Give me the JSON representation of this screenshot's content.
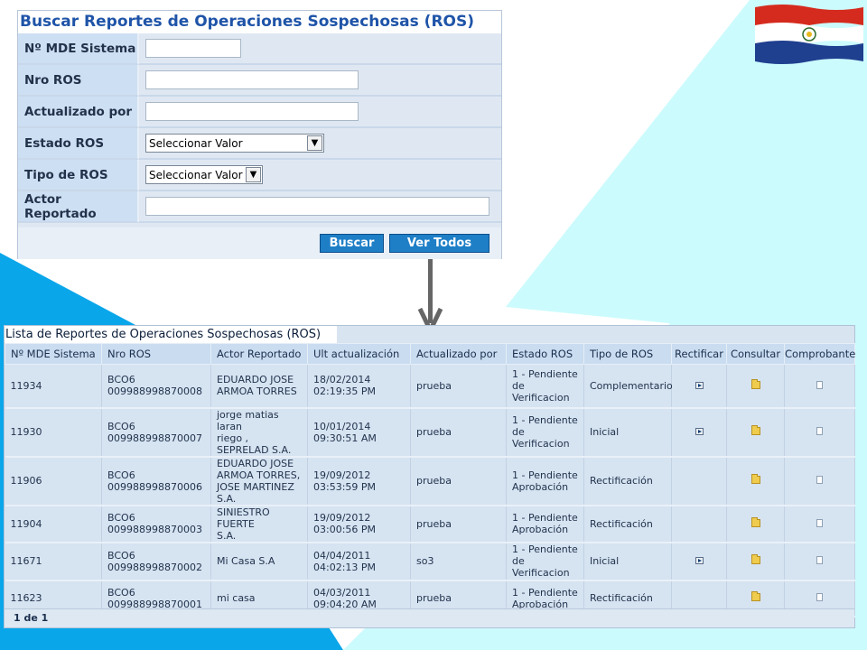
{
  "search": {
    "title": "Buscar Reportes de Operaciones Sospechosas (ROS)",
    "fields": [
      {
        "label": "Nº MDE Sistema",
        "type": "text",
        "value": ""
      },
      {
        "label": "Nro ROS",
        "type": "text",
        "value": ""
      },
      {
        "label": "Actualizado por",
        "type": "text",
        "value": ""
      },
      {
        "label": "Estado ROS",
        "type": "select",
        "value": "Seleccionar Valor"
      },
      {
        "label": "Tipo de ROS",
        "type": "select",
        "value": "Seleccionar Valor"
      },
      {
        "label": "Actor Reportado",
        "type": "text",
        "value": ""
      }
    ],
    "buttons": {
      "search": "Buscar",
      "view_all": "Ver Todos"
    }
  },
  "list": {
    "title": "Lista de Reportes de Operaciones Sospechosas (ROS)",
    "columns": [
      "Nº MDE Sistema",
      "Nro ROS",
      "Actor Reportado",
      "Ult actualización",
      "Actualizado por",
      "Estado ROS",
      "Tipo de ROS",
      "Rectificar",
      "Consultar",
      "Comprobante"
    ],
    "rows": [
      {
        "mde": "11934",
        "nro_ros": [
          "BCO6",
          "009988998870008"
        ],
        "actor": [
          "EDUARDO JOSE",
          "ARMOA TORRES"
        ],
        "updated": [
          "18/02/2014",
          "02:19:35 PM"
        ],
        "by": "prueba",
        "estado": [
          "1 - Pendiente",
          "de",
          "Verificacion"
        ],
        "tipo": "Complementario",
        "rectificar": true
      },
      {
        "mde": "11930",
        "nro_ros": [
          "BCO6",
          "009988998870007"
        ],
        "actor": [
          "jorge matias laran",
          "riego ,",
          "SEPRELAD S.A."
        ],
        "updated": [
          "10/01/2014",
          "09:30:51 AM"
        ],
        "by": "prueba",
        "estado": [
          "1 - Pendiente",
          "de",
          "Verificacion"
        ],
        "tipo": "Inicial",
        "rectificar": true
      },
      {
        "mde": "11906",
        "nro_ros": [
          "BCO6",
          "009988998870006"
        ],
        "actor": [
          "EDUARDO JOSE",
          "ARMOA TORRES,",
          "JOSE MARTINEZ",
          "S.A."
        ],
        "updated": [
          "19/09/2012",
          "03:53:59 PM"
        ],
        "by": "prueba",
        "estado": [
          "1 - Pendiente",
          "Aprobación"
        ],
        "tipo": "Rectificación",
        "rectificar": false
      },
      {
        "mde": "11904",
        "nro_ros": [
          "BCO6",
          "009988998870003"
        ],
        "actor": [
          "SINIESTRO FUERTE",
          "S.A."
        ],
        "updated": [
          "19/09/2012",
          "03:00:56 PM"
        ],
        "by": "prueba",
        "estado": [
          "1 - Pendiente",
          "Aprobación"
        ],
        "tipo": "Rectificación",
        "rectificar": false
      },
      {
        "mde": "11671",
        "nro_ros": [
          "BCO6",
          "009988998870002"
        ],
        "actor": [
          "Mi Casa S.A"
        ],
        "updated": [
          "04/04/2011",
          "04:02:13 PM"
        ],
        "by": "so3",
        "estado": [
          "1 - Pendiente",
          "de",
          "Verificacion"
        ],
        "tipo": "Inicial",
        "rectificar": true
      },
      {
        "mde": "11623",
        "nro_ros": [
          "BCO6",
          "009988998870001"
        ],
        "actor": [
          "mi casa"
        ],
        "updated": [
          "04/03/2011",
          "09:04:20 AM"
        ],
        "by": "prueba",
        "estado": [
          "1 - Pendiente",
          "Aprobación"
        ],
        "tipo": "Rectificación",
        "rectificar": false
      }
    ],
    "pagination": "1 de 1"
  },
  "colors": {
    "accent": "#1e7fc7",
    "title_blue": "#1f54a8",
    "background_cyan": "#ccfbfd",
    "shape_blue": "#0aa6ea"
  }
}
